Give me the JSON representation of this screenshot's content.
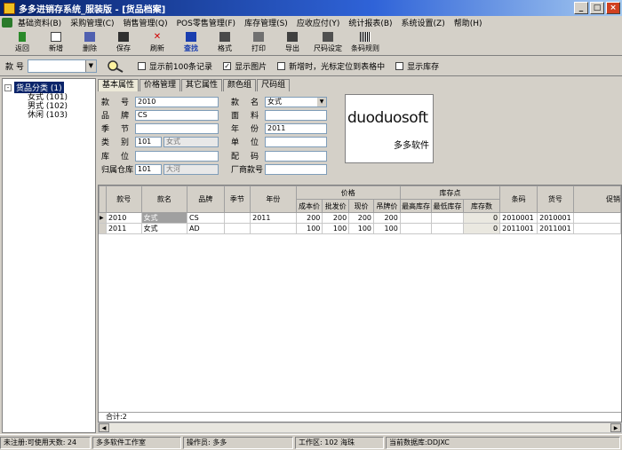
{
  "window": {
    "title": "多多进销存系统_服装版 - [货品档案]",
    "minimize": "_",
    "restore": "□",
    "close": "×"
  },
  "menu": [
    "基础资料(B)",
    "采购管理(C)",
    "销售管理(Q)",
    "POS零售管理(F)",
    "库存管理(S)",
    "应收应付(Y)",
    "统计报表(B)",
    "系统设置(Z)",
    "帮助(H)"
  ],
  "toolbar": {
    "back": "返回",
    "add": "新增",
    "delete": "删除",
    "save": "保存",
    "refresh": "刷新",
    "find": "查找",
    "format": "格式",
    "print": "打印",
    "export": "导出",
    "size_setting": "尺码设定",
    "barcode_rule": "条码规则"
  },
  "search": {
    "label": "款 号",
    "value": "",
    "show_100": "显示前100条记录",
    "show_image": "显示图片",
    "cursor_on_add": "新增时，光标定位到表格中",
    "show_stock": "显示库存",
    "checked_mark": "✓"
  },
  "tree": {
    "root": "货品分类 (1)",
    "children": [
      "女式 (101)",
      "男式 (102)",
      "休闲 (103)"
    ],
    "expander": "-"
  },
  "tabs": [
    "基本属性",
    "价格管理",
    "其它属性",
    "颜色组",
    "尺码组"
  ],
  "form": {
    "style_no_label": "款　号",
    "style_no": "2010",
    "brand_label": "品　牌",
    "brand": "CS",
    "season_label": "季　节",
    "season": "",
    "category_label": "类　别",
    "category_code": "101",
    "category_name": "女式",
    "location_label": "库　位",
    "location": "",
    "warehouse_label": "归属仓库",
    "warehouse_code": "101",
    "warehouse_name": "大河",
    "style_name_label": "款　名",
    "style_name": "女式",
    "fabric_label": "面　料",
    "fabric": "",
    "year_label": "年　份",
    "year": "2011",
    "unit_label": "单　位",
    "unit": "",
    "match_label": "配　码",
    "match": "",
    "vendor_no_label": "厂商款号",
    "vendor_no": ""
  },
  "logo": {
    "brand": "duoduosoft",
    "sub": "多多软件"
  },
  "grid": {
    "headers_top": {
      "style_no": "款号",
      "style_name": "款名",
      "brand": "品牌",
      "season": "季节",
      "year": "年份",
      "price_group": "价格",
      "stock_group": "库存点",
      "barcode": "条码",
      "item_no": "货号",
      "promo": "促销"
    },
    "headers_price": [
      "成本价",
      "批发价",
      "现价",
      "吊牌价"
    ],
    "headers_stock": [
      "最高库存",
      "最低库存",
      "库存数"
    ],
    "row_marker": "▶",
    "rows": [
      {
        "style_no": "2010",
        "style_name": "女式",
        "brand": "CS",
        "season": "",
        "year": "2011",
        "cost": "200",
        "wholesale": "200",
        "current": "200",
        "tag": "200",
        "max_stock": "",
        "min_stock": "",
        "stock": "0",
        "barcode": "2010001",
        "item_no": "2010001"
      },
      {
        "style_no": "2011",
        "style_name": "女式",
        "brand": "AD",
        "season": "",
        "year": "",
        "cost": "100",
        "wholesale": "100",
        "current": "100",
        "tag": "100",
        "max_stock": "",
        "min_stock": "",
        "stock": "0",
        "barcode": "2011001",
        "item_no": "2011001"
      }
    ],
    "total": "合计:2"
  },
  "status": {
    "reg": "未注册:可使用天数: 24",
    "company": "多多软件工作室",
    "operator": "操作员: 多多",
    "workspace": "工作区: 102 海珠",
    "database": "当前数据库:DDJXC"
  }
}
